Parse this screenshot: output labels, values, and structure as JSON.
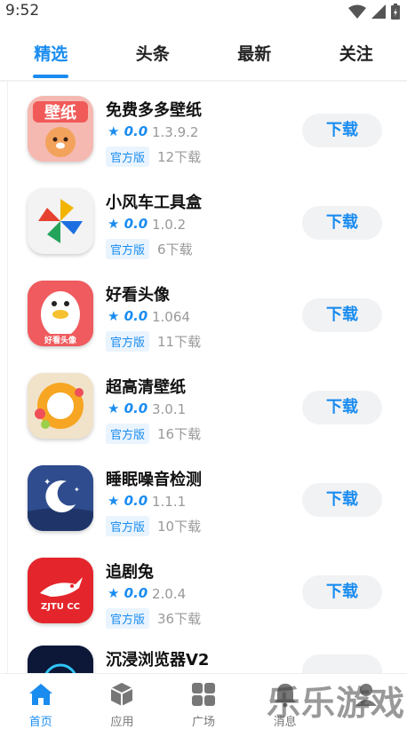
{
  "status": {
    "time": "9:52"
  },
  "tabs": [
    "精选",
    "头条",
    "最新",
    "关注"
  ],
  "apps": [
    {
      "name": "免费多多壁纸",
      "rating": "★ 0.0",
      "version": "1.3.9.2",
      "badge": "官方版",
      "downloads": "12下载",
      "button": "下载"
    },
    {
      "name": "小风车工具盒",
      "rating": "★ 0.0",
      "version": "1.0.2",
      "badge": "官方版",
      "downloads": "6下载",
      "button": "下载"
    },
    {
      "name": "好看头像",
      "rating": "★ 0.0",
      "version": "1.064",
      "badge": "官方版",
      "downloads": "11下载",
      "button": "下载"
    },
    {
      "name": "超高清壁纸",
      "rating": "★ 0.0",
      "version": "3.0.1",
      "badge": "官方版",
      "downloads": "16下载",
      "button": "下载"
    },
    {
      "name": "睡眠噪音检测",
      "rating": "★ 0.0",
      "version": "1.1.1",
      "badge": "官方版",
      "downloads": "10下载",
      "button": "下载"
    },
    {
      "name": "追剧兔",
      "rating": "★ 0.0",
      "version": "2.0.4",
      "badge": "官方版",
      "downloads": "36下载",
      "button": "下载"
    },
    {
      "name": "沉浸浏览器V2",
      "rating": "",
      "version": "",
      "badge": "",
      "downloads": "",
      "button": ""
    }
  ],
  "icon_texts": {
    "wallpaper": "壁纸",
    "avatar": "好看头像",
    "zjtu": "ZJTU CC"
  },
  "nav": [
    {
      "label": "首页",
      "icon": "home-icon"
    },
    {
      "label": "应用",
      "icon": "cube-icon"
    },
    {
      "label": "广场",
      "icon": "grid-icon"
    },
    {
      "label": "消息",
      "icon": "bell-icon"
    },
    {
      "label": "",
      "icon": "user-icon"
    }
  ],
  "watermark": "乐乐游戏",
  "colors": {
    "accent": "#1a8cf0",
    "button_bg": "#f1f2f4",
    "badge_bg": "#eaf4fe"
  }
}
